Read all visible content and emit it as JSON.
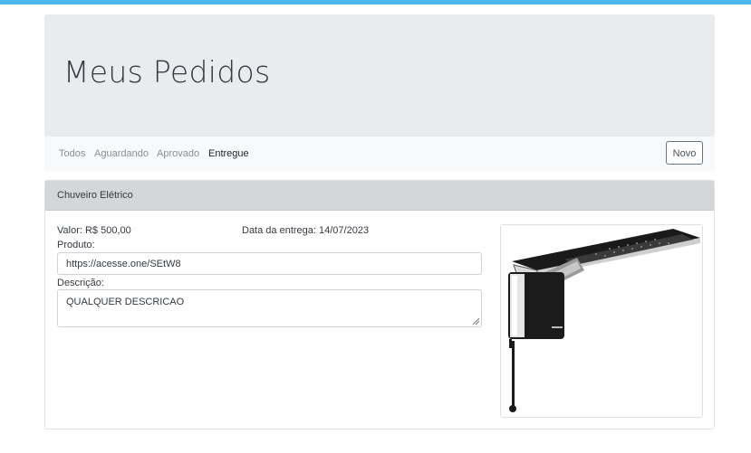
{
  "header": {
    "title": "Meus Pedidos"
  },
  "nav": {
    "items": [
      {
        "label": "Todos",
        "active": false
      },
      {
        "label": "Aguardando",
        "active": false
      },
      {
        "label": "Aprovado",
        "active": false
      },
      {
        "label": "Entregue",
        "active": true
      }
    ],
    "new_button": "Novo"
  },
  "order": {
    "title": "Chuveiro Elétrico",
    "value_label": "Valor: R$ 500,00",
    "delivery_label": "Data da entrega: 14/07/2023",
    "product_label": "Produto:",
    "product_value": "https://acesse.one/SEtW8",
    "description_label": "Descrição:",
    "description_value": "QUALQUER DESCRICAO",
    "image_icon": "electric-shower-product-image"
  },
  "colors": {
    "top_bar": "#4db8ee",
    "jumbotron_bg": "#e9ecef",
    "navbar_bg": "#f8f9fa",
    "card_header_bg": "#d4d6d8"
  }
}
